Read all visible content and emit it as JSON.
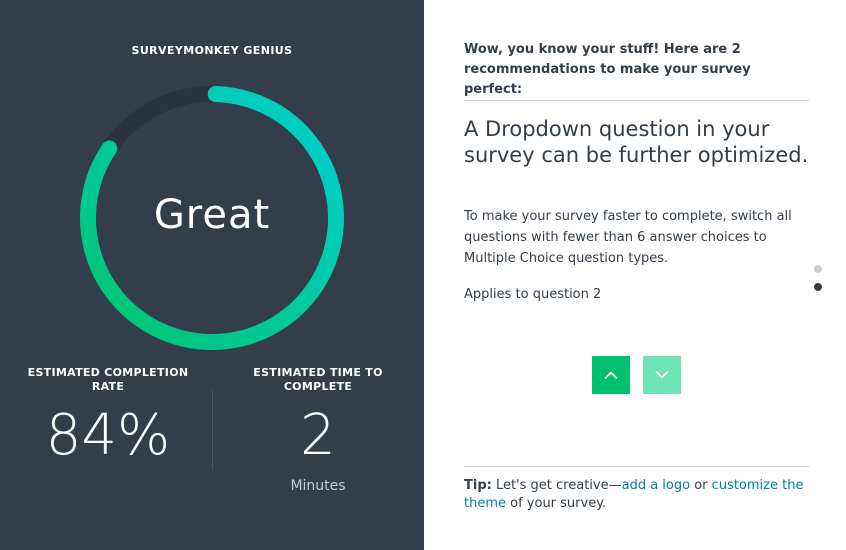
{
  "genius": {
    "title": "SURVEYMONKEY GENIUS",
    "rating": "Great",
    "score_fraction": 0.84,
    "colors": {
      "background": "#343e4a",
      "ring_track": "#2b343e",
      "ring_start": "#00c46f",
      "ring_end": "#00cfd0"
    },
    "completion_rate": {
      "label": "ESTIMATED COMPLETION RATE",
      "value": "84%"
    },
    "time_to_complete": {
      "label": "ESTIMATED TIME TO COMPLETE",
      "value": "2",
      "unit": "Minutes"
    }
  },
  "recommendations": {
    "header": "Wow, you know your stuff! Here are 2 recommendations to make your survey perfect:",
    "title": "A Dropdown question in your survey can be further optimized.",
    "body": "To make your survey faster to complete, switch all questions with fewer than 6 answer choices to Multiple Choice question types.",
    "applies": "Applies to question 2",
    "pagination": {
      "total": 2,
      "current": 2
    },
    "icons": {
      "up": "chevron-up-icon",
      "down": "chevron-down-icon"
    },
    "colors": {
      "up_button": "#00bf6f",
      "down_button": "#6ee3b5",
      "link": "#007faa"
    }
  },
  "tip": {
    "label": "Tip:",
    "text_before": " Let's get creative—",
    "link_logo": "add a logo",
    "text_middle": " or ",
    "link_theme": "customize the theme",
    "text_after": " of your survey."
  }
}
